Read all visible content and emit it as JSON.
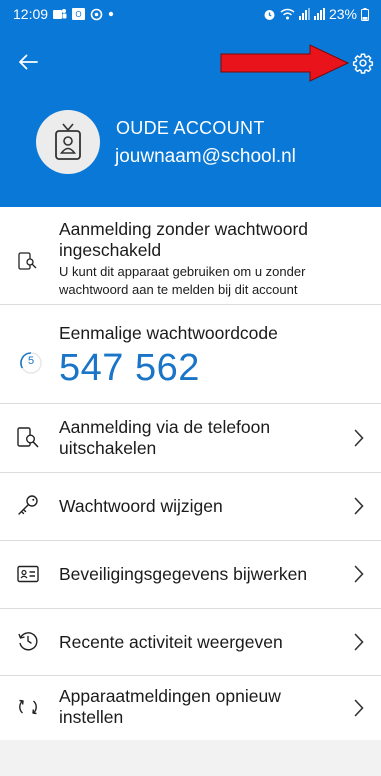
{
  "status_bar": {
    "time": "12:09",
    "battery": "23%",
    "icons": [
      "teams-icon",
      "outlook-icon",
      "circle-status-icon",
      "dot-icon",
      "alarm-icon",
      "wifi-icon",
      "signal-icon",
      "signal-icon",
      "battery-icon"
    ]
  },
  "header": {
    "back_icon": "arrow-left-icon",
    "settings_icon": "gear-icon",
    "account_name": "OUDE ACCOUNT",
    "account_email": "jouwnaam@school.nl",
    "avatar_icon": "id-badge-icon",
    "background_color": "#0a78d7",
    "annotation": {
      "type": "red-arrow",
      "color": "#e8131b"
    }
  },
  "passwordless": {
    "icon": "phone-key-icon",
    "title_line1": "Aanmelding zonder wachtwoord",
    "title_line2": "ingeschakeld",
    "desc_line1": "U kunt dit apparaat gebruiken om u zonder",
    "desc_line2": "wachtwoord aan te melden bij dit account"
  },
  "otp": {
    "label": "Eenmalige wachtwoordcode",
    "timer": "5",
    "code": "547 562",
    "accent_color": "#1a74c7"
  },
  "menu": [
    {
      "icon": "phone-signin-icon",
      "line1": "Aanmelding via de telefoon",
      "line2": "uitschakelen"
    },
    {
      "icon": "key-icon",
      "line1": "Wachtwoord wijzigen",
      "line2": ""
    },
    {
      "icon": "id-card-icon",
      "line1": "Beveiligingsgegevens bijwerken",
      "line2": ""
    },
    {
      "icon": "history-icon",
      "line1": "Recente activiteit weergeven",
      "line2": ""
    },
    {
      "icon": "sync-icon",
      "line1": "Apparaatmeldingen opnieuw",
      "line2": "instellen"
    }
  ]
}
